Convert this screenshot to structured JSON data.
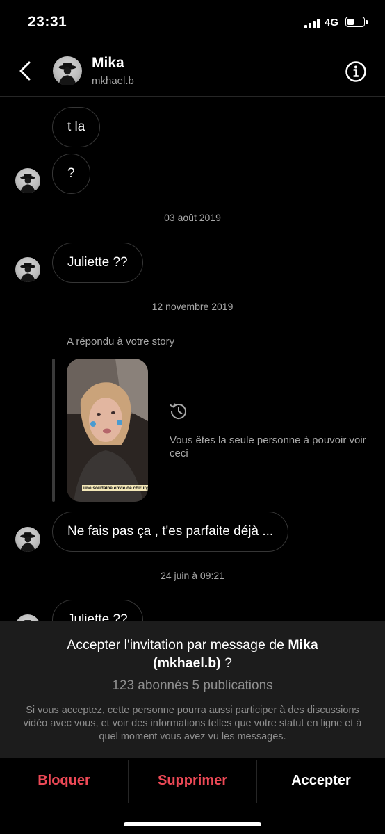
{
  "status_bar": {
    "time": "23:31",
    "network": "4G",
    "battery_level": 0.45
  },
  "header": {
    "name": "Mika",
    "handle": "mkhael.b"
  },
  "messages": [
    {
      "text": "t la"
    },
    {
      "text": "?"
    },
    {
      "text": "Juliette ??"
    },
    {
      "text": "Ne fais pas ça , t'es parfaite déjà ..."
    },
    {
      "text": "Juliette ??"
    }
  ],
  "dates": [
    "03 août 2019",
    "12 novembre 2019",
    "24 juin à 09:21"
  ],
  "story_reply": {
    "label": "A répondu à votre story",
    "caption": "une soudaine envie de chirurgie",
    "note": "Vous êtes la seule personne à pouvoir voir ceci"
  },
  "invitation": {
    "title_prefix": "Accepter l'invitation par message de ",
    "name": "Mika",
    "handle_paren": "(mkhael.b)",
    "title_suffix": " ?",
    "stats": "123 abonnés 5 publications",
    "description": "Si vous acceptez, cette personne pourra aussi participer à des discussions vidéo avec vous, et voir des informations telles que votre statut en ligne et à quel moment vous avez vu les messages."
  },
  "actions": {
    "block": "Bloquer",
    "delete": "Supprimer",
    "accept": "Accepter"
  },
  "colors": {
    "destructive": "#ed4956",
    "background": "#000000",
    "panel": "#1c1c1c"
  }
}
